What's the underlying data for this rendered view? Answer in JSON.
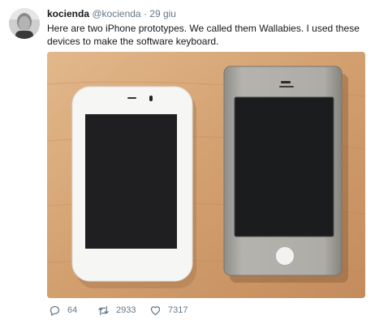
{
  "tweet": {
    "author_name": "kocienda",
    "author_handle": "@kocienda",
    "separator": "·",
    "date": "29 giu",
    "text": "Here are two iPhone prototypes. We called them Wallabies. I used these devices to make the software keyboard.",
    "replies": "64",
    "retweets": "2933",
    "likes": "7317"
  },
  "colors": {
    "secondary_text": "#657786",
    "primary_text": "#14171a",
    "wood": "#d8a97a",
    "white_device": "#f6f6f4",
    "silver_device": "#a8a6a1",
    "screen": "#1c1c1e"
  },
  "icons": {
    "reply": "reply-icon",
    "retweet": "retweet-icon",
    "like": "heart-icon"
  }
}
